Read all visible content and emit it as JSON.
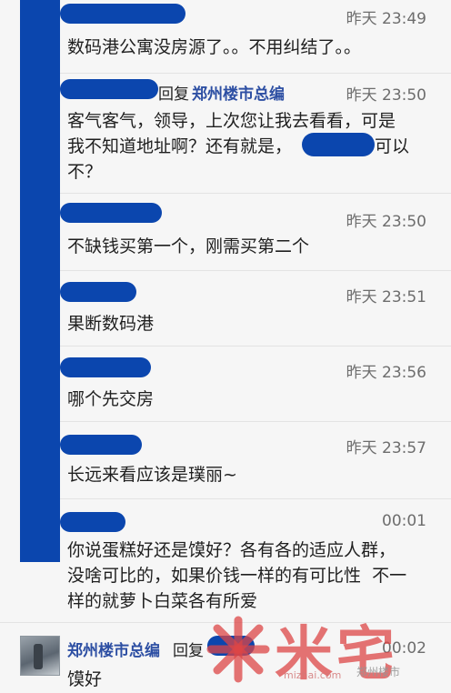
{
  "posts": [
    {
      "time": "昨天 23:49",
      "text": "数码港公寓没房源了。。不用纠结了。。"
    },
    {
      "reply_word": "回复",
      "reply_target": "郑州楼市总编",
      "time": "昨天 23:50",
      "text_line1": "客气客气，领导，上次您让我去看看，可是",
      "text_line2_start": "我不知道地址啊？还有就是，",
      "text_line2_end": "可以",
      "text_line3": "不？"
    },
    {
      "time": "昨天 23:50",
      "text": "不缺钱买第一个，刚需买第二个"
    },
    {
      "time": "昨天 23:51",
      "text": "果断数码港"
    },
    {
      "time": "昨天 23:56",
      "text": "哪个先交房"
    },
    {
      "time": "昨天 23:57",
      "text": "长远来看应该是璞丽~"
    },
    {
      "time": "00:01",
      "text": "你说蛋糕好还是馍好？各有各的适应人群，\n没啥可比的，如果价钱一样的有可比性  不一\n样的就萝卜白菜各有所爱"
    },
    {
      "author": "郑州楼市总编",
      "reply_word": "回复",
      "time": "00:02",
      "text": "馍好"
    }
  ],
  "watermark": {
    "logo_text": "米宅",
    "caption": "郑州楼市",
    "url": "mizhai.com"
  },
  "colors": {
    "accent_blue": "#0b46ae",
    "name_blue": "#2d4fa3",
    "watermark_red": "#dc4646"
  }
}
